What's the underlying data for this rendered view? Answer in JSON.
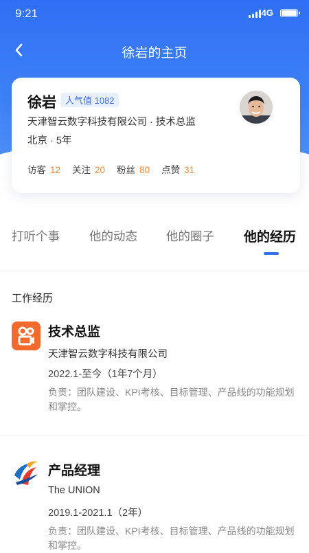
{
  "status_bar": {
    "time": "9:21",
    "network": "4G"
  },
  "nav": {
    "title": "徐岩的主页"
  },
  "profile": {
    "name": "徐岩",
    "popularity": "人气值 1082",
    "company_title": "天津智云数字科技有限公司 · 技术总监",
    "location_years": "北京 · 5年",
    "stats": [
      {
        "label": "访客",
        "value": "12"
      },
      {
        "label": "关注",
        "value": "20"
      },
      {
        "label": "粉丝",
        "value": "80"
      },
      {
        "label": "点赞",
        "value": "31"
      }
    ]
  },
  "tabs": [
    {
      "label": "打听个事"
    },
    {
      "label": "他的动态"
    },
    {
      "label": "他的圈子"
    },
    {
      "label": "他的经历",
      "active": true
    }
  ],
  "section": {
    "title": "工作经历"
  },
  "experience": [
    {
      "role": "技术总监",
      "company": "天津智云数字科技有限公司",
      "duration": "2022.1-至今（1年7个月）",
      "description": "负责：团队建设、KPI考核、目标管理、产品线的功能规划和掌控。",
      "logo": "kuaishou-logo"
    },
    {
      "role": "产品经理",
      "company": "The UNION",
      "duration": "2019.1-2021.1（2年）",
      "description": "负责：团队建设、KPI考核、目标管理、产品线的功能规划和掌控。",
      "logo": "union-logo"
    }
  ],
  "colors": {
    "primary": "#3b6fe6",
    "stat_value": "#f08a3c",
    "kuaishou": "#f26a2e"
  }
}
